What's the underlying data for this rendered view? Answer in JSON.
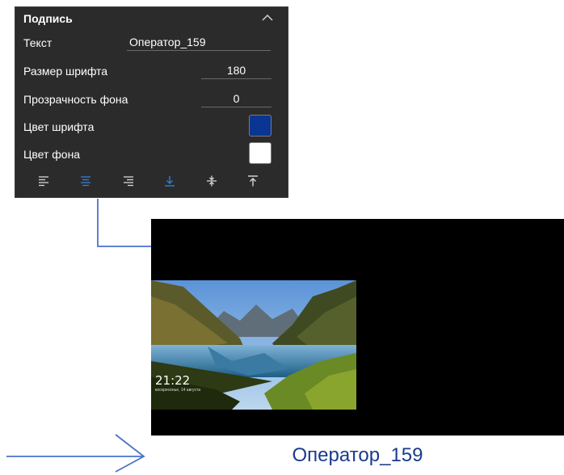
{
  "panel": {
    "title": "Подпись",
    "rows": {
      "text": {
        "label": "Текст",
        "value": "Оператор_159"
      },
      "font_size": {
        "label": "Размер шрифта",
        "value": "180"
      },
      "bg_opacity": {
        "label": "Прозрачность фона",
        "value": "0"
      },
      "font_color": {
        "label": "Цвет шрифта",
        "color": "#0a3592"
      },
      "bg_color": {
        "label": "Цвет фона",
        "color": "#ffffff"
      }
    },
    "toolbar_icons": [
      "align-left-icon",
      "align-center-icon",
      "align-right-icon",
      "align-bottom-icon",
      "align-middle-icon",
      "align-top-icon"
    ],
    "active_icon_color": "#2f7fd6"
  },
  "preview": {
    "lock_time": "21:22",
    "lock_date": "воскресенье, 14 августа",
    "caption": "Оператор_159",
    "caption_color": "#1a3a8c"
  },
  "connector_color": "#4a73c9"
}
